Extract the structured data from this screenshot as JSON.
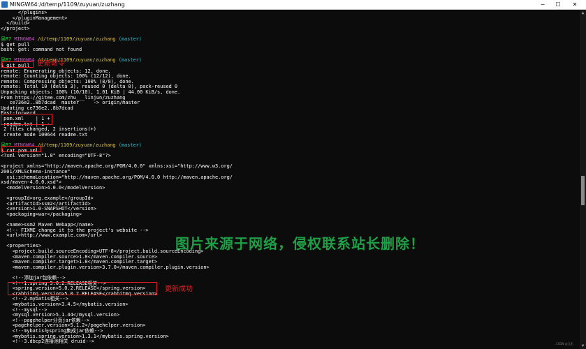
{
  "window": {
    "title": "MINGW64:/d/temp/1109/zuyuan/zuzhang",
    "minimize_label": "─",
    "maximize_label": "☐",
    "close_label": "✕"
  },
  "prompt": {
    "user": "吴R7",
    "host": "MINGW64",
    "path": "/d/temp/1109/zuyuan/zuzhang",
    "branch": "(master)"
  },
  "terminal": {
    "pre_lines": [
      "      </plugins>",
      "    </pluginManagement>",
      "  </build>",
      "</project>"
    ],
    "cmd1": "$ get pull",
    "cmd1_output": "bash: get: command not found",
    "cmd2": "$ git pull",
    "pull_output": [
      "remote: Enumerating objects: 12, done.",
      "remote: Counting objects: 100% (12/12), done.",
      "remote: Compressing objects: 100% (8/8), done.",
      "remote: Total 10 (delta 3), reused 0 (delta 0), pack-reused 0",
      "Unpacking objects: 100% (10/10), 1.01 KiB | 44.00 KiB/s, done.",
      "From https://gitee.com/zhu___linjun/zuzhang",
      "   ce736e2..8b7dcad  master     -> origin/master",
      "Updating ce736e2..8b7dcad",
      "Fast-forward",
      " pom.xml    | 1 +",
      " readme.txt | 1 -",
      " 2 files changed, 2 insertions(+)",
      " create mode 100644 readme.txt"
    ],
    "cmd3": "$ cat pom.xml",
    "xml_lines": [
      "<?xml version=\"1.0\" encoding=\"UTF-8\"?>",
      "",
      "<project xmlns=\"http://maven.apache.org/POM/4.0.0\" xmlns:xsi=\"http://www.w3.org/",
      "2001/XMLSchema-instance\"",
      "  xsi:schemaLocation=\"http://maven.apache.org/POM/4.0.0 http://maven.apache.org/",
      "xsd/maven-4.0.0.xsd\">",
      "  <modelVersion>4.0.0</modelVersion>",
      "",
      "  <groupId>org.example</groupId>",
      "  <artifactId>ssm2</artifactId>",
      "  <version>1.0-SNAPSHOT</version>",
      "  <packaging>war</packaging>",
      "",
      "  <name>ssm2 Maven Webapp</name>",
      "  <!-- FIXME change it to the project's website -->",
      "  <url>http://www.example.com</url>",
      "",
      "  <properties>",
      "    <project.build.sourceEncoding>UTF-8</project.build.sourceEncoding>",
      "    <maven.compiler.source>1.8</maven.compiler.source>",
      "    <maven.compiler.target>1.8</maven.compiler.target>",
      "    <maven.compiler.plugin.version>3.7.0</maven.compiler.plugin.version>",
      "",
      "    <!--添加jar包依赖-->",
      "    <!--1.spring 5.0.2.RELEASE相关-->",
      "    <spring.version>5.0.2.RELEASE</spring.version>",
      "    <rabbitmq.version>5.0.2.RELEASE</rabbitmq.version>",
      "    <!--2.mybatis相关-->",
      "    <mybatis.version>3.4.5</mybatis.version>",
      "    <!--mysql-->",
      "    <mysql.version>5.1.44</mysql.version>",
      "    <!--pagehelper分页jar依赖-->",
      "    <pagehelper.version>5.1.2</pagehelper.version>",
      "    <!--mybatis与spring集成jar依赖-->",
      "    <mybatis.spring.version>1.3.1</mybatis.spring.version>",
      "    <!--3.dbcp2连接池相关 druid-->"
    ]
  },
  "annotations": {
    "update_command": "更新命令",
    "update_success": "更新成功",
    "watermark": "图片来源于网络，侵权联系站长删除！",
    "footer": "CSDN @几无"
  },
  "colors": {
    "background": "#0c0c0c",
    "text": "#ffffff",
    "prompt_user": "#2ecc40",
    "prompt_host": "#c050c0",
    "prompt_path": "#d7c24a",
    "prompt_branch": "#34c6d0",
    "annotation": "#e02020",
    "watermark": "#25d05a"
  },
  "icons": {
    "app": "mingw-terminal-icon",
    "scroll_up": "scroll-up-arrow-icon",
    "scroll_down": "scroll-down-arrow-icon"
  }
}
